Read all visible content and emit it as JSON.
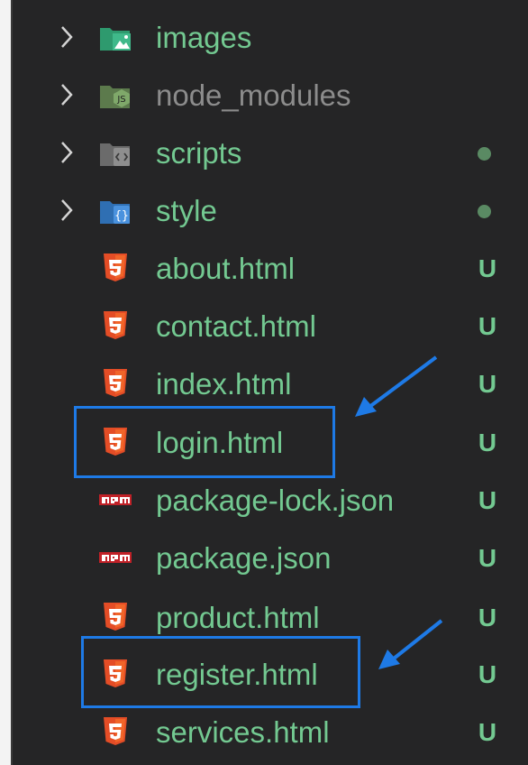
{
  "explorer": {
    "folders": [
      {
        "label": "images",
        "icon": "images-folder-icon"
      },
      {
        "label": "node_modules",
        "icon": "node-modules-folder-icon"
      },
      {
        "label": "scripts",
        "icon": "scripts-folder-icon"
      },
      {
        "label": "style",
        "icon": "style-folder-icon"
      }
    ],
    "files": [
      {
        "label": "about.html",
        "status": "U",
        "icon": "html5-icon"
      },
      {
        "label": "contact.html",
        "status": "U",
        "icon": "html5-icon"
      },
      {
        "label": "index.html",
        "status": "U",
        "icon": "html5-icon"
      },
      {
        "label": "login.html",
        "status": "U",
        "icon": "html5-icon"
      },
      {
        "label": "package-lock.json",
        "status": "U",
        "icon": "npm-icon"
      },
      {
        "label": "package.json",
        "status": "U",
        "icon": "npm-icon"
      },
      {
        "label": "product.html",
        "status": "U",
        "icon": "html5-icon"
      },
      {
        "label": "register.html",
        "status": "U",
        "icon": "html5-icon"
      },
      {
        "label": "services.html",
        "status": "U",
        "icon": "html5-icon"
      }
    ]
  },
  "colors": {
    "background": "#252526",
    "untracked_text": "#73c991",
    "ignored_text": "#8c8c8c",
    "annotation": "#1e7ae6"
  }
}
